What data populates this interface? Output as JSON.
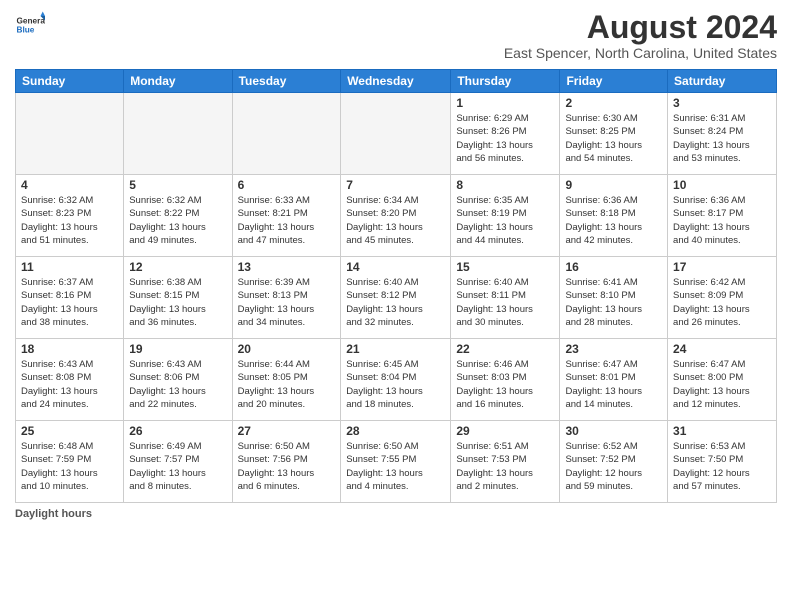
{
  "logo": {
    "line1": "General",
    "line2": "Blue"
  },
  "header": {
    "title": "August 2024",
    "subtitle": "East Spencer, North Carolina, United States"
  },
  "weekdays": [
    "Sunday",
    "Monday",
    "Tuesday",
    "Wednesday",
    "Thursday",
    "Friday",
    "Saturday"
  ],
  "weeks": [
    [
      {
        "day": "",
        "info": ""
      },
      {
        "day": "",
        "info": ""
      },
      {
        "day": "",
        "info": ""
      },
      {
        "day": "",
        "info": ""
      },
      {
        "day": "1",
        "info": "Sunrise: 6:29 AM\nSunset: 8:26 PM\nDaylight: 13 hours\nand 56 minutes."
      },
      {
        "day": "2",
        "info": "Sunrise: 6:30 AM\nSunset: 8:25 PM\nDaylight: 13 hours\nand 54 minutes."
      },
      {
        "day": "3",
        "info": "Sunrise: 6:31 AM\nSunset: 8:24 PM\nDaylight: 13 hours\nand 53 minutes."
      }
    ],
    [
      {
        "day": "4",
        "info": "Sunrise: 6:32 AM\nSunset: 8:23 PM\nDaylight: 13 hours\nand 51 minutes."
      },
      {
        "day": "5",
        "info": "Sunrise: 6:32 AM\nSunset: 8:22 PM\nDaylight: 13 hours\nand 49 minutes."
      },
      {
        "day": "6",
        "info": "Sunrise: 6:33 AM\nSunset: 8:21 PM\nDaylight: 13 hours\nand 47 minutes."
      },
      {
        "day": "7",
        "info": "Sunrise: 6:34 AM\nSunset: 8:20 PM\nDaylight: 13 hours\nand 45 minutes."
      },
      {
        "day": "8",
        "info": "Sunrise: 6:35 AM\nSunset: 8:19 PM\nDaylight: 13 hours\nand 44 minutes."
      },
      {
        "day": "9",
        "info": "Sunrise: 6:36 AM\nSunset: 8:18 PM\nDaylight: 13 hours\nand 42 minutes."
      },
      {
        "day": "10",
        "info": "Sunrise: 6:36 AM\nSunset: 8:17 PM\nDaylight: 13 hours\nand 40 minutes."
      }
    ],
    [
      {
        "day": "11",
        "info": "Sunrise: 6:37 AM\nSunset: 8:16 PM\nDaylight: 13 hours\nand 38 minutes."
      },
      {
        "day": "12",
        "info": "Sunrise: 6:38 AM\nSunset: 8:15 PM\nDaylight: 13 hours\nand 36 minutes."
      },
      {
        "day": "13",
        "info": "Sunrise: 6:39 AM\nSunset: 8:13 PM\nDaylight: 13 hours\nand 34 minutes."
      },
      {
        "day": "14",
        "info": "Sunrise: 6:40 AM\nSunset: 8:12 PM\nDaylight: 13 hours\nand 32 minutes."
      },
      {
        "day": "15",
        "info": "Sunrise: 6:40 AM\nSunset: 8:11 PM\nDaylight: 13 hours\nand 30 minutes."
      },
      {
        "day": "16",
        "info": "Sunrise: 6:41 AM\nSunset: 8:10 PM\nDaylight: 13 hours\nand 28 minutes."
      },
      {
        "day": "17",
        "info": "Sunrise: 6:42 AM\nSunset: 8:09 PM\nDaylight: 13 hours\nand 26 minutes."
      }
    ],
    [
      {
        "day": "18",
        "info": "Sunrise: 6:43 AM\nSunset: 8:08 PM\nDaylight: 13 hours\nand 24 minutes."
      },
      {
        "day": "19",
        "info": "Sunrise: 6:43 AM\nSunset: 8:06 PM\nDaylight: 13 hours\nand 22 minutes."
      },
      {
        "day": "20",
        "info": "Sunrise: 6:44 AM\nSunset: 8:05 PM\nDaylight: 13 hours\nand 20 minutes."
      },
      {
        "day": "21",
        "info": "Sunrise: 6:45 AM\nSunset: 8:04 PM\nDaylight: 13 hours\nand 18 minutes."
      },
      {
        "day": "22",
        "info": "Sunrise: 6:46 AM\nSunset: 8:03 PM\nDaylight: 13 hours\nand 16 minutes."
      },
      {
        "day": "23",
        "info": "Sunrise: 6:47 AM\nSunset: 8:01 PM\nDaylight: 13 hours\nand 14 minutes."
      },
      {
        "day": "24",
        "info": "Sunrise: 6:47 AM\nSunset: 8:00 PM\nDaylight: 13 hours\nand 12 minutes."
      }
    ],
    [
      {
        "day": "25",
        "info": "Sunrise: 6:48 AM\nSunset: 7:59 PM\nDaylight: 13 hours\nand 10 minutes."
      },
      {
        "day": "26",
        "info": "Sunrise: 6:49 AM\nSunset: 7:57 PM\nDaylight: 13 hours\nand 8 minutes."
      },
      {
        "day": "27",
        "info": "Sunrise: 6:50 AM\nSunset: 7:56 PM\nDaylight: 13 hours\nand 6 minutes."
      },
      {
        "day": "28",
        "info": "Sunrise: 6:50 AM\nSunset: 7:55 PM\nDaylight: 13 hours\nand 4 minutes."
      },
      {
        "day": "29",
        "info": "Sunrise: 6:51 AM\nSunset: 7:53 PM\nDaylight: 13 hours\nand 2 minutes."
      },
      {
        "day": "30",
        "info": "Sunrise: 6:52 AM\nSunset: 7:52 PM\nDaylight: 12 hours\nand 59 minutes."
      },
      {
        "day": "31",
        "info": "Sunrise: 6:53 AM\nSunset: 7:50 PM\nDaylight: 12 hours\nand 57 minutes."
      }
    ]
  ],
  "footer": {
    "label": "Daylight hours",
    "text": "Daylight hours"
  }
}
